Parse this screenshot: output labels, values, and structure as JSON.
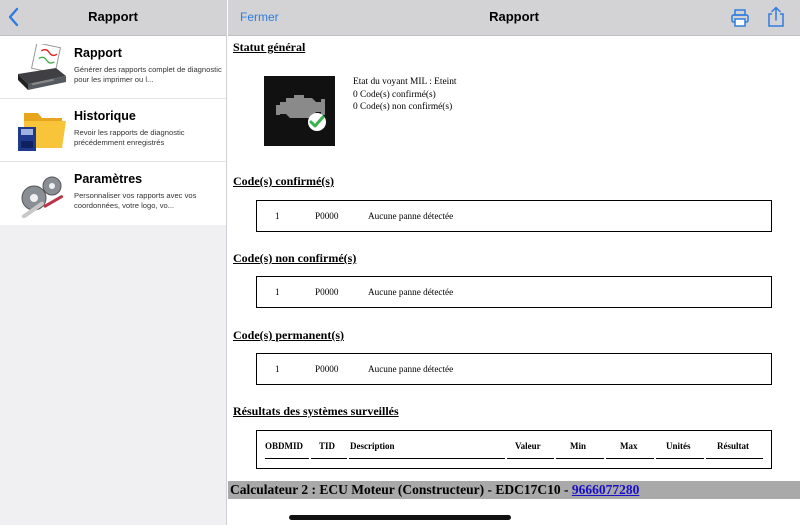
{
  "left_panel": {
    "title": "Rapport",
    "back_icon": "chevron-left-icon",
    "items": [
      {
        "title": "Rapport",
        "desc": "Générer des rapports complet de diagnostic pour les imprimer ou l...",
        "icon": "printer-report-icon"
      },
      {
        "title": "Historique",
        "desc": "Revoir les rapports de diagnostic précédemment enregistrés",
        "icon": "folder-history-icon"
      },
      {
        "title": "Paramètres",
        "desc": "Personnaliser vos rapports avec vos coordonnées, votre logo, vo...",
        "icon": "gears-settings-icon"
      }
    ]
  },
  "right_panel": {
    "close_label": "Fermer",
    "title": "Rapport",
    "print_icon": "printer-icon",
    "share_icon": "share-icon",
    "accent": "#2f7ce0"
  },
  "report": {
    "status_title": "Statut général",
    "mil_lines": [
      "Etat du voyant MIL : Eteint",
      "0 Code(s) confirmé(s)",
      "0 Code(s) non confirmé(s)"
    ],
    "sections": [
      {
        "title": "Code(s) confirmé(s)",
        "row": {
          "num": "1",
          "code": "P0000",
          "desc": "Aucune panne détectée"
        }
      },
      {
        "title": "Code(s) non confirmé(s)",
        "row": {
          "num": "1",
          "code": "P0000",
          "desc": "Aucune panne détectée"
        }
      },
      {
        "title": "Code(s) permanent(s)",
        "row": {
          "num": "1",
          "code": "P0000",
          "desc": "Aucune panne détectée"
        }
      }
    ],
    "systems_title": "Résultats des systèmes surveillés",
    "systems_columns": [
      "OBDMID",
      "TID",
      "Description",
      "Valeur",
      "Min",
      "Max",
      "Unités",
      "Résultat"
    ],
    "banner_text": "Calculateur 2 : ECU Moteur (Constructeur) - EDC17C10 - ",
    "banner_link": "9666077280"
  }
}
